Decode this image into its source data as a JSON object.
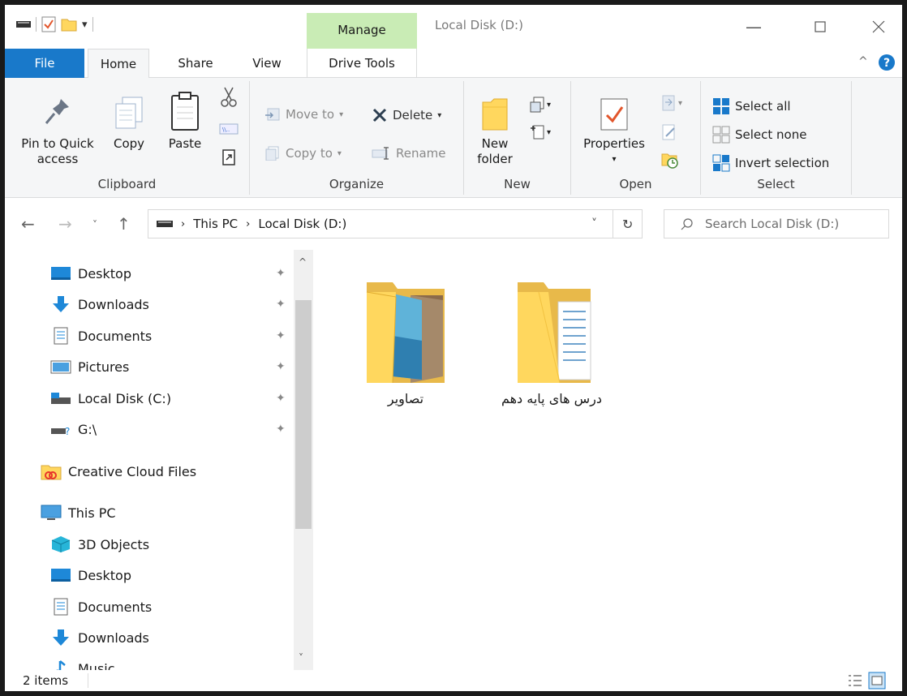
{
  "titlebar": {
    "manage_tab": "Manage",
    "window_title": "Local Disk (D:)"
  },
  "tabs": {
    "file": "File",
    "home": "Home",
    "share": "Share",
    "view": "View",
    "drive_tools": "Drive Tools"
  },
  "ribbon": {
    "clipboard": {
      "pin_line1": "Pin to Quick",
      "pin_line2": "access",
      "copy": "Copy",
      "paste": "Paste",
      "label": "Clipboard"
    },
    "organize": {
      "move_to": "Move to",
      "copy_to": "Copy to",
      "delete": "Delete",
      "rename": "Rename",
      "label": "Organize"
    },
    "new": {
      "new_line1": "New",
      "new_line2": "folder",
      "label": "New"
    },
    "open": {
      "properties": "Properties",
      "label": "Open"
    },
    "select": {
      "select_all": "Select all",
      "select_none": "Select none",
      "invert_selection": "Invert selection",
      "label": "Select"
    }
  },
  "address": {
    "crumb1": "This PC",
    "crumb2": "Local Disk (D:)",
    "search_placeholder": "Search Local Disk (D:)"
  },
  "navpane": {
    "items": [
      {
        "label": "Desktop",
        "icon": "desktop-icon",
        "pinned": true
      },
      {
        "label": "Downloads",
        "icon": "downloads-icon",
        "pinned": true
      },
      {
        "label": "Documents",
        "icon": "documents-icon",
        "pinned": true
      },
      {
        "label": "Pictures",
        "icon": "pictures-icon",
        "pinned": true
      },
      {
        "label": "Local Disk (C:)",
        "icon": "drive-icon",
        "pinned": true
      },
      {
        "label": "G:\\",
        "icon": "drive-icon",
        "pinned": true
      },
      {
        "label": "Creative Cloud Files",
        "icon": "creative-cloud-icon"
      },
      {
        "label": "This PC",
        "icon": "computer-icon"
      },
      {
        "label": "3D Objects",
        "icon": "3d-objects-icon"
      },
      {
        "label": "Desktop",
        "icon": "desktop-icon"
      },
      {
        "label": "Documents",
        "icon": "documents-icon"
      },
      {
        "label": "Downloads",
        "icon": "downloads-icon"
      },
      {
        "label": "Music",
        "icon": "music-icon"
      }
    ]
  },
  "files": [
    {
      "name": "تصاویر",
      "icon": "pictures-folder-icon"
    },
    {
      "name": "درس های پایه دهم",
      "icon": "documents-folder-icon"
    }
  ],
  "status": {
    "count": "2 items"
  },
  "colors": {
    "file_tab": "#1979ca",
    "manage_tab": "#c9ecb5",
    "ribbon_bg": "#f5f6f7"
  }
}
